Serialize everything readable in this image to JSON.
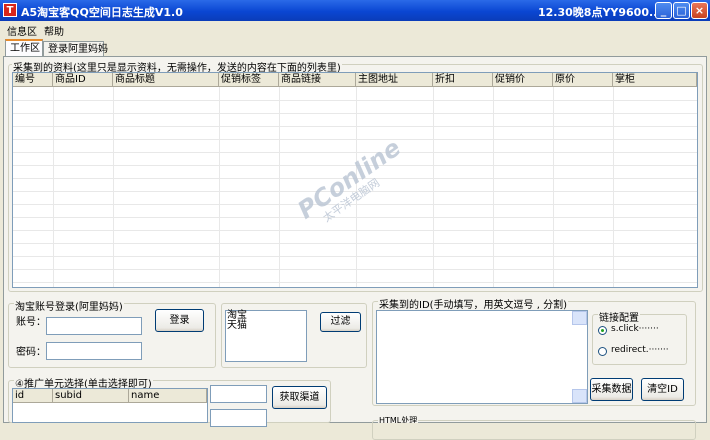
{
  "window": {
    "title": "A5淘宝客QQ空间日志生成V1.0",
    "right_text": "12.30晚8点YY9600...",
    "icon_letter": "T",
    "min_glyph": "_",
    "max_glyph": "□",
    "close_glyph": "×"
  },
  "menu": [
    "信息区",
    "帮助"
  ],
  "tabs": [
    {
      "label": "工作区"
    },
    {
      "label": "登录阿里妈妈"
    }
  ],
  "collected": {
    "legend": "采集到的资料(这里只是显示资料，无需操作，发送的内容在下面的列表里)",
    "columns": [
      "编号",
      "商品ID",
      "商品标题",
      "促销标签",
      "商品链接",
      "主图地址",
      "折扣",
      "促销价",
      "原价",
      "掌柜"
    ]
  },
  "watermark": {
    "main": "PConline",
    "sub": "太平洋电脑网"
  },
  "login": {
    "legend": "淘宝账号登录(阿里妈妈)",
    "account_label": "账号：",
    "password_label": "密码：",
    "login_button": "登录"
  },
  "platform": {
    "options": [
      "淘宝",
      "天猫"
    ],
    "filter_button": "过滤"
  },
  "ids": {
    "legend": "采集到的ID(手动填写，用英文逗号 , 分割)",
    "link_config_legend": "链接配置",
    "radio1": "s.click·······",
    "radio2": "redirect.·······",
    "collect_button": "采集数据",
    "clear_button": "清空ID"
  },
  "promo": {
    "legend": "④推广单元选择(单击选择即可)",
    "columns": [
      "id",
      "subid",
      "name"
    ],
    "get_channel_button": "获取渠道"
  },
  "html_section": {
    "legend": "HTML处理"
  }
}
